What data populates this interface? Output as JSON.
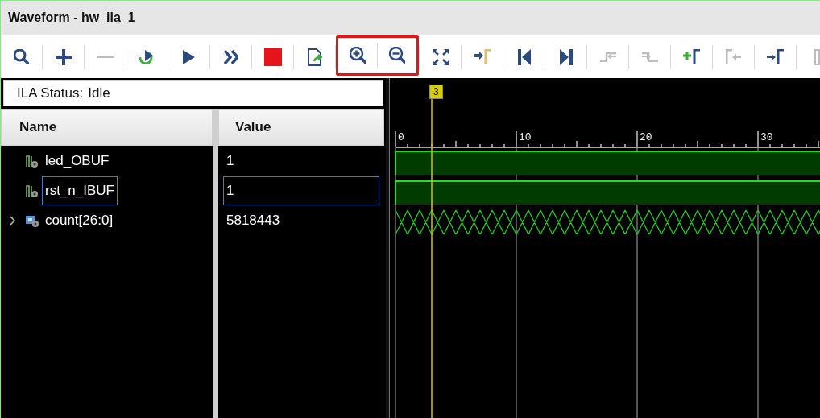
{
  "window": {
    "title": "Waveform - hw_ila_1"
  },
  "toolbar": [
    {
      "kind": "search",
      "disabled": false,
      "highlighted": false
    },
    {
      "kind": "add",
      "disabled": false,
      "highlighted": false
    },
    {
      "kind": "remove",
      "disabled": true,
      "highlighted": false
    },
    {
      "kind": "run_trigger_immediate",
      "disabled": false,
      "highlighted": false
    },
    {
      "kind": "run",
      "disabled": false,
      "highlighted": false
    },
    {
      "kind": "run_continuous",
      "disabled": false,
      "highlighted": false
    },
    {
      "kind": "stop",
      "disabled": false,
      "highlighted": false
    },
    {
      "kind": "export",
      "disabled": false,
      "highlighted": false
    },
    {
      "kind": "zoom_in",
      "disabled": false,
      "highlighted": true
    },
    {
      "kind": "zoom_out",
      "disabled": false,
      "highlighted": true
    },
    {
      "kind": "zoom_fit",
      "disabled": false,
      "highlighted": false
    },
    {
      "kind": "goto_cursor",
      "disabled": false,
      "highlighted": false
    },
    {
      "kind": "goto_start",
      "disabled": false,
      "highlighted": false
    },
    {
      "kind": "goto_end",
      "disabled": false,
      "highlighted": false
    },
    {
      "kind": "prev_transition",
      "disabled": true,
      "highlighted": false
    },
    {
      "kind": "next_transition",
      "disabled": true,
      "highlighted": false
    },
    {
      "kind": "add_marker",
      "disabled": false,
      "highlighted": false
    },
    {
      "kind": "prev_marker",
      "disabled": true,
      "highlighted": false
    },
    {
      "kind": "next_marker",
      "disabled": false,
      "highlighted": false
    },
    {
      "kind": "partial",
      "disabled": true,
      "highlighted": false
    }
  ],
  "status": {
    "label": "ILA Status:",
    "value": "Idle"
  },
  "table": {
    "columns": [
      "Name",
      "Value"
    ],
    "rows": [
      {
        "kind": "bit",
        "name": "led_OBUF",
        "value": "1",
        "selected": false
      },
      {
        "kind": "bit",
        "name": "rst_n_IBUF",
        "value": "1",
        "selected": true
      },
      {
        "kind": "bus",
        "name": "count[26:0]",
        "value": "5818443",
        "selected": false
      }
    ]
  },
  "waveform": {
    "cursor": {
      "label": "3"
    },
    "ruler": [
      "0",
      "10",
      "20",
      "30"
    ]
  }
}
